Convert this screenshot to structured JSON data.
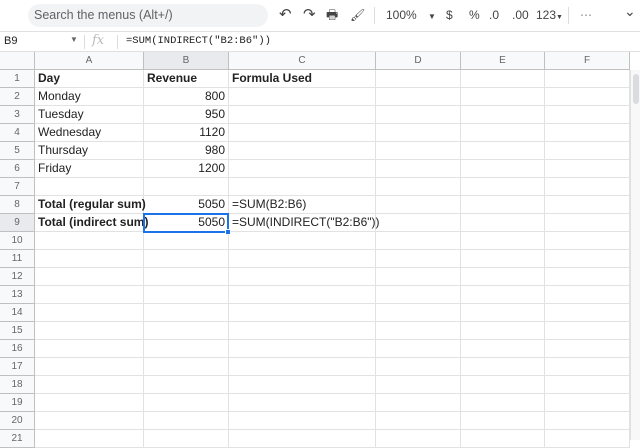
{
  "toolbar": {
    "search_placeholder": "Search the menus (Alt+/)",
    "undo": "↶",
    "redo": "↷",
    "print": "🖶",
    "paint_format": "🖌",
    "zoom": "100%",
    "currency": "$",
    "percent": "%",
    "decrease_decimal": ".0",
    "increase_decimal": ".00",
    "more_formats": "123",
    "more": "⋯",
    "collapse": "⌄"
  },
  "formula_bar": {
    "name_box": "B9",
    "fx": "fx",
    "formula": "=SUM(INDIRECT(\"B2:B6\"))"
  },
  "columns": [
    "A",
    "B",
    "C",
    "D",
    "E",
    "F"
  ],
  "selected_cell": {
    "row": 9,
    "col": "B"
  },
  "rows": [
    {
      "n": "1",
      "cells": [
        "Day",
        "Revenue",
        "Formula Used"
      ],
      "bold": true
    },
    {
      "n": "2",
      "cells": [
        "Monday",
        "800",
        ""
      ]
    },
    {
      "n": "3",
      "cells": [
        "Tuesday",
        "950",
        ""
      ]
    },
    {
      "n": "4",
      "cells": [
        "Wednesday",
        "1120",
        ""
      ]
    },
    {
      "n": "5",
      "cells": [
        "Thursday",
        "980",
        ""
      ]
    },
    {
      "n": "6",
      "cells": [
        "Friday",
        "1200",
        ""
      ]
    },
    {
      "n": "7",
      "cells": [
        "",
        "",
        ""
      ]
    },
    {
      "n": "8",
      "cells": [
        "Total (regular sum)",
        "5050",
        "=SUM(B2:B6)"
      ],
      "boldA": true
    },
    {
      "n": "9",
      "cells": [
        "Total (indirect sum)",
        "5050",
        "=SUM(INDIRECT(\"B2:B6\"))"
      ],
      "boldA": true
    },
    {
      "n": "10",
      "cells": [
        "",
        "",
        ""
      ]
    },
    {
      "n": "11",
      "cells": [
        "",
        "",
        ""
      ]
    },
    {
      "n": "12",
      "cells": [
        "",
        "",
        ""
      ]
    },
    {
      "n": "13",
      "cells": [
        "",
        "",
        ""
      ]
    },
    {
      "n": "14",
      "cells": [
        "",
        "",
        ""
      ]
    },
    {
      "n": "15",
      "cells": [
        "",
        "",
        ""
      ]
    },
    {
      "n": "16",
      "cells": [
        "",
        "",
        ""
      ]
    },
    {
      "n": "17",
      "cells": [
        "",
        "",
        ""
      ]
    },
    {
      "n": "18",
      "cells": [
        "",
        "",
        ""
      ]
    },
    {
      "n": "19",
      "cells": [
        "",
        "",
        ""
      ]
    },
    {
      "n": "20",
      "cells": [
        "",
        "",
        ""
      ]
    },
    {
      "n": "21",
      "cells": [
        "",
        "",
        ""
      ]
    }
  ]
}
